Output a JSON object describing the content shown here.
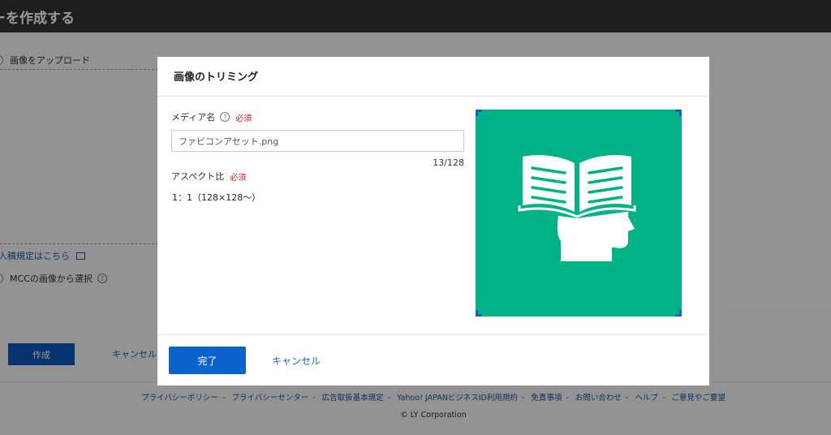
{
  "page": {
    "title": "ーを作成する",
    "upload_option": "画像をアップロード",
    "guide_link": "入稿規定はこちら",
    "mcc_option": "MCCの画像から選択",
    "create_button": "作成",
    "cancel_button": "キャンセル"
  },
  "footer": {
    "links": [
      "プライバシーポリシー",
      "プライバシーセンター",
      "広告取扱基本規定",
      "Yahoo! JAPANビジネスID利用規約",
      "免責事項",
      "お問い合わせ",
      "ヘルプ",
      "ご意見やご要望"
    ],
    "separator": "-",
    "copyright": "© LY Corporation"
  },
  "modal": {
    "title": "画像のトリミング",
    "media_name_label": "メディア名",
    "help_glyph": "?",
    "required_label": "必須",
    "media_name_value": "ファビコンアセット.png",
    "char_count": "13/128",
    "aspect_label": "アスペクト比",
    "aspect_value": "1：1（128×128〜）",
    "done_button": "完了",
    "cancel_button": "キャンセル"
  },
  "colors": {
    "header": "#333333",
    "accent": "#0a63cc",
    "required": "#c81f1f",
    "crop_background": "#00b386"
  },
  "icons": {
    "crop_image": "book-head-icon",
    "help": "question-circle-icon",
    "external": "external-window-icon"
  }
}
